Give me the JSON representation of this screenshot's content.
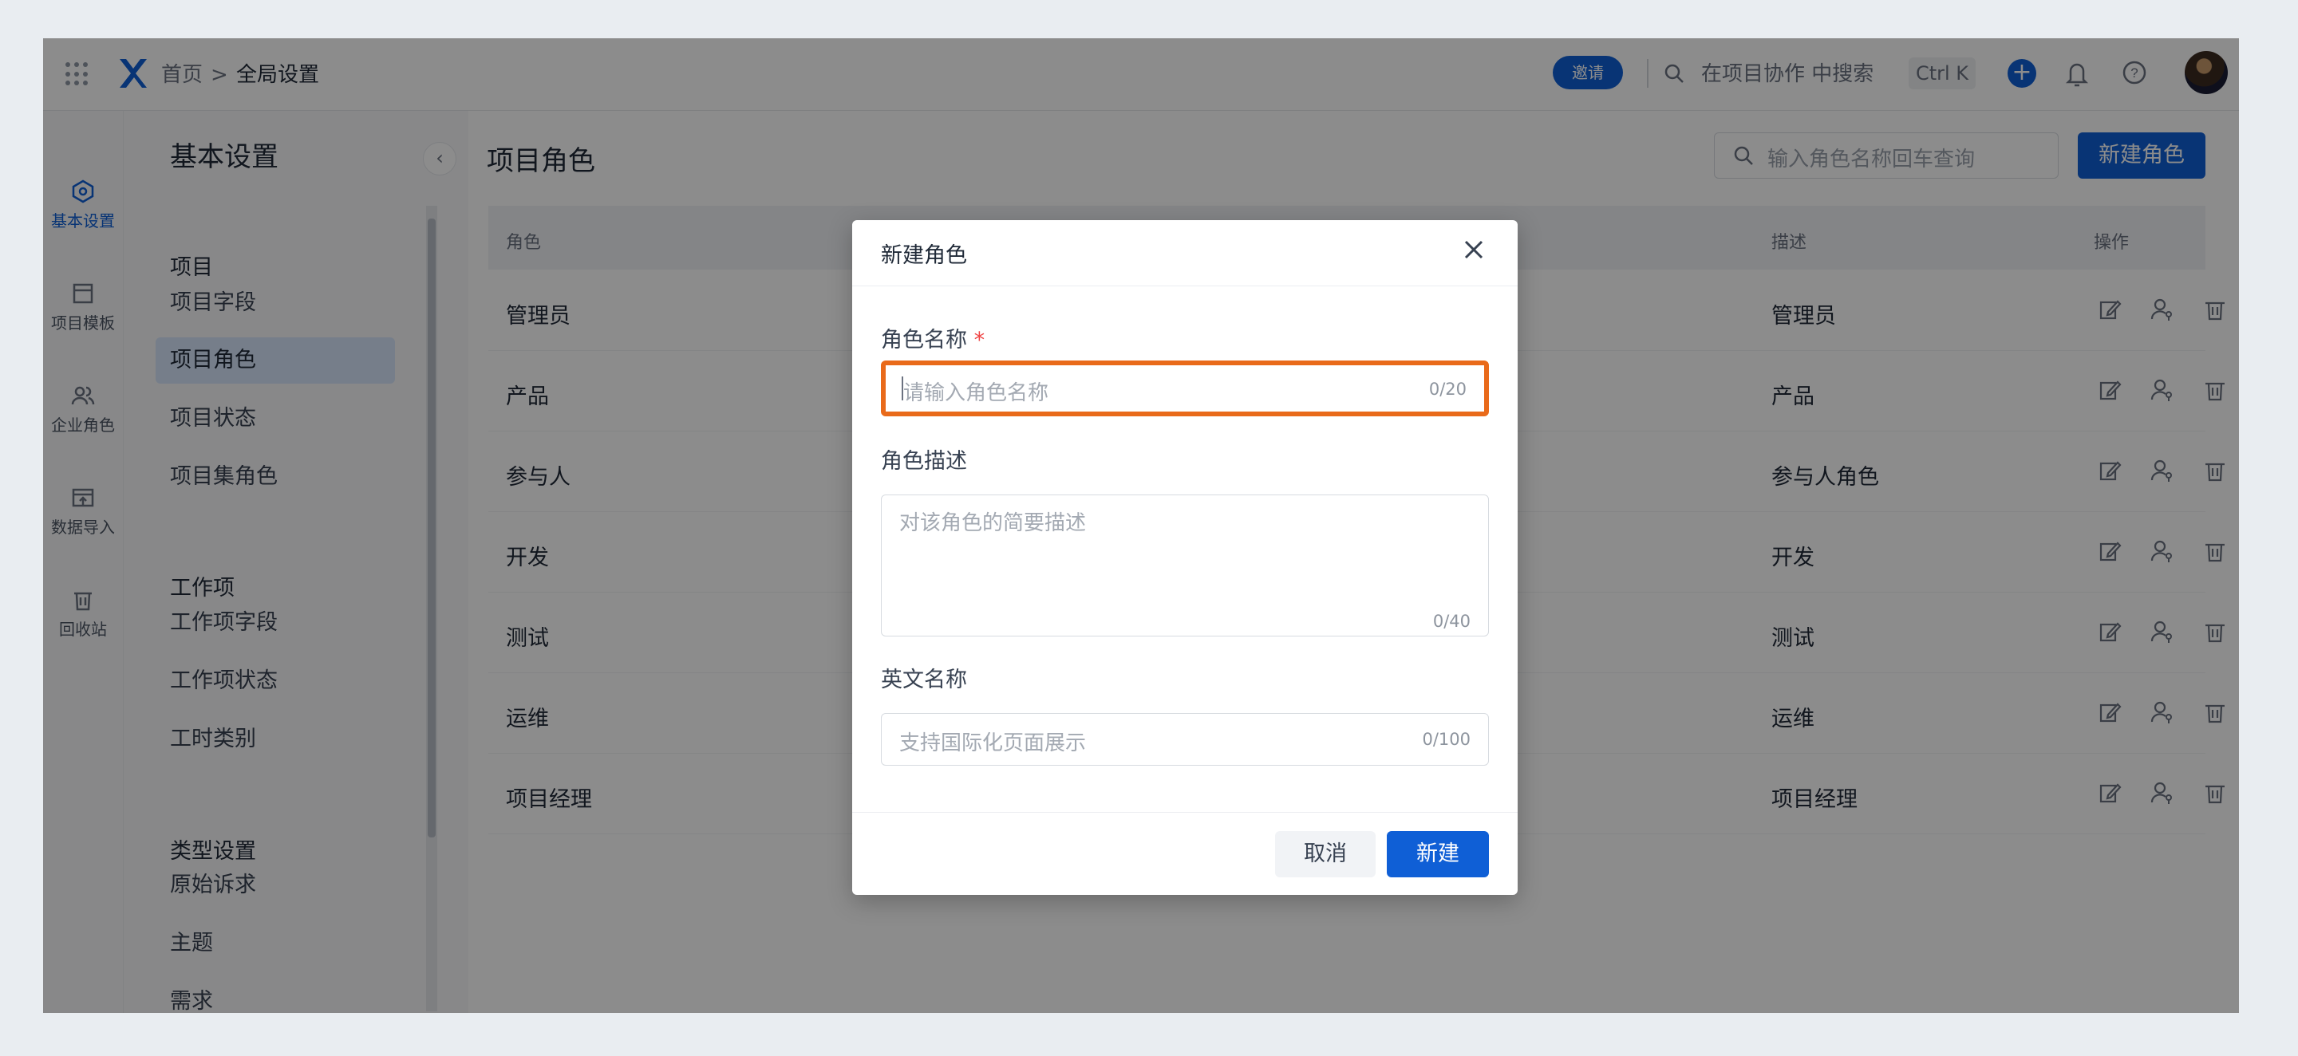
{
  "topbar": {
    "breadcrumb_home": "首页",
    "breadcrumb_separator": ">",
    "breadcrumb_current": "全局设置",
    "invite_label": "邀请",
    "search_placeholder": "在项目协作 中搜索",
    "shortcut": "Ctrl K",
    "plus_icon": "plus-icon",
    "bell_icon": "bell-icon",
    "help_icon": "help-icon"
  },
  "rail": {
    "items": [
      {
        "label": "基本设置",
        "icon": "hexagon-settings-icon",
        "active": true
      },
      {
        "label": "项目模板",
        "icon": "template-icon",
        "active": false
      },
      {
        "label": "企业角色",
        "icon": "users-icon",
        "active": false
      },
      {
        "label": "数据导入",
        "icon": "import-icon",
        "active": false
      },
      {
        "label": "回收站",
        "icon": "trash-icon",
        "active": false
      }
    ]
  },
  "sidebar": {
    "title": "基本设置",
    "groups": [
      {
        "label": "项目",
        "items": [
          "项目字段",
          "项目角色",
          "项目状态",
          "项目集角色"
        ]
      },
      {
        "label": "工作项",
        "items": [
          "工作项字段",
          "工作项状态",
          "工时类别"
        ]
      },
      {
        "label": "类型设置",
        "items": [
          "原始诉求",
          "主题",
          "需求"
        ]
      }
    ],
    "active_item": "项目角色",
    "collapse_icon": "chevron-left-icon"
  },
  "main": {
    "title": "项目角色",
    "search_placeholder": "输入角色名称回车查询",
    "new_role_label": "新建角色",
    "columns": {
      "role": "角色",
      "description": "描述",
      "actions": "操作"
    },
    "rows": [
      {
        "role": "管理员",
        "description": "管理员"
      },
      {
        "role": "产品",
        "description": "产品"
      },
      {
        "role": "参与人",
        "description": "参与人角色"
      },
      {
        "role": "开发",
        "description": "开发"
      },
      {
        "role": "测试",
        "description": "测试"
      },
      {
        "role": "运维",
        "description": "运维"
      },
      {
        "role": "项目经理",
        "description": "项目经理"
      }
    ]
  },
  "modal": {
    "title": "新建角色",
    "name_label": "角色名称",
    "required_mark": "*",
    "name_placeholder": "请输入角色名称",
    "name_counter": "0/20",
    "desc_label": "角色描述",
    "desc_placeholder": "对该角色的简要描述",
    "desc_counter": "0/40",
    "en_label": "英文名称",
    "en_placeholder": "支持国际化页面展示",
    "en_counter": "0/100",
    "cancel_label": "取消",
    "create_label": "新建"
  },
  "colors": {
    "primary": "#0f5fd6",
    "focus_highlight": "#e96a1a",
    "required": "#ef4444"
  }
}
